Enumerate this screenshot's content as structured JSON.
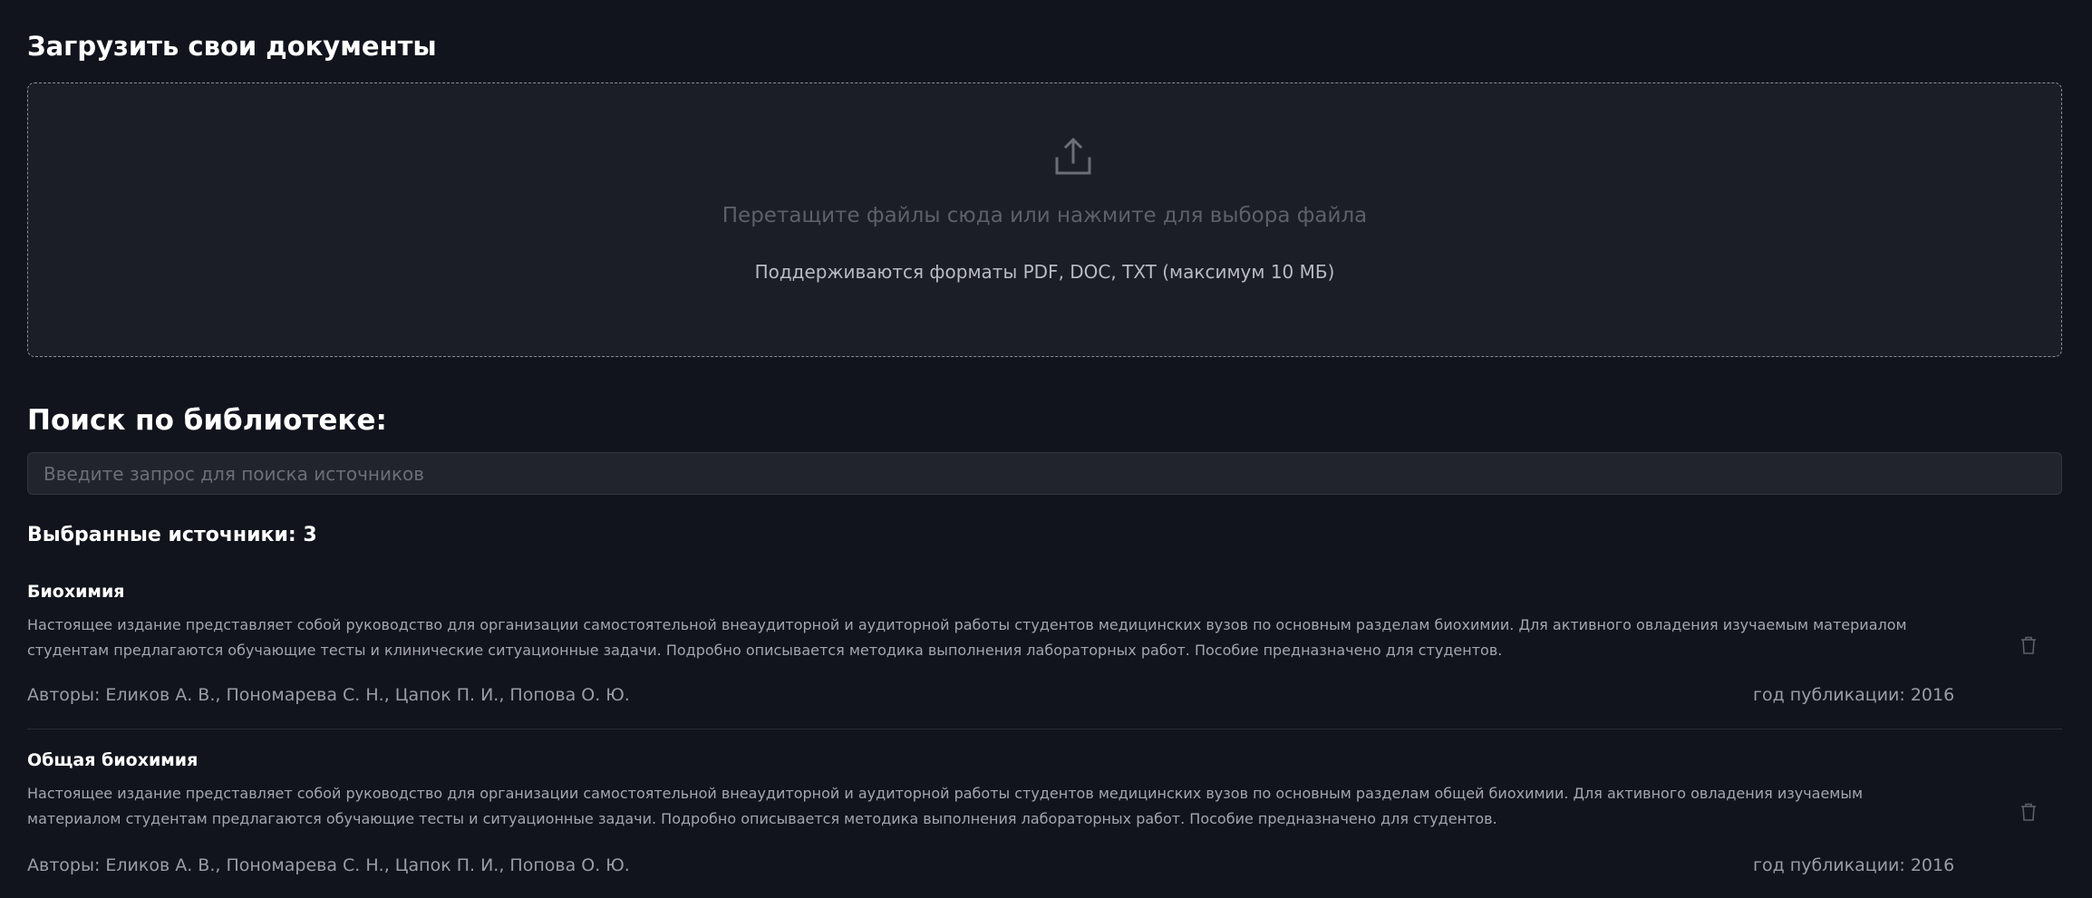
{
  "upload": {
    "title": "Загрузить свои документы",
    "dropzone_text": "Перетащите файлы сюда или нажмите для выбора файла",
    "dropzone_hint": "Поддерживаются форматы PDF, DOC, TXT (максимум 10 МБ)",
    "icon": "upload-icon"
  },
  "search": {
    "title": "Поиск по библиотеке:",
    "placeholder": "Введите запрос для поиска источников",
    "value": ""
  },
  "selected": {
    "label": "Выбранные источники: 3"
  },
  "sources": [
    {
      "title": "Биохимия",
      "description": "Настоящее издание представляет собой руководство для организации самостоятельной внеаудиторной и аудиторной работы студентов медицинских вузов по основным разделам биохимии. Для активного овладения изучаемым материалом студентам предлагаются обучающие тесты и клинические ситуационные задачи. Подробно описывается методика выполнения лабораторных работ. Пособие предназначено для студентов.",
      "authors": "Авторы: Еликов А. В., Пономарева С. Н., Цапок П. И., Попова О. Ю.",
      "year": "год публикации: 2016"
    },
    {
      "title": "Общая биохимия",
      "description": "Настоящее издание представляет собой руководство для организации самостоятельной внеаудиторной и аудиторной работы студентов медицинских вузов по основным разделам общей биохимии. Для активного овладения изучаемым материалом студентам предлагаются обучающие тесты и ситуационные задачи. Подробно описывается методика выполнения лабораторных работ. Пособие предназначено для студентов.",
      "authors": "Авторы: Еликов А. В., Пономарева С. Н., Цапок П. И., Попова О. Ю.",
      "year": "год публикации: 2016"
    }
  ],
  "colors": {
    "background": "#12141d",
    "dropzone_bg": "#1b1d27",
    "input_bg": "#22242d",
    "muted_text": "#9a9da6"
  }
}
